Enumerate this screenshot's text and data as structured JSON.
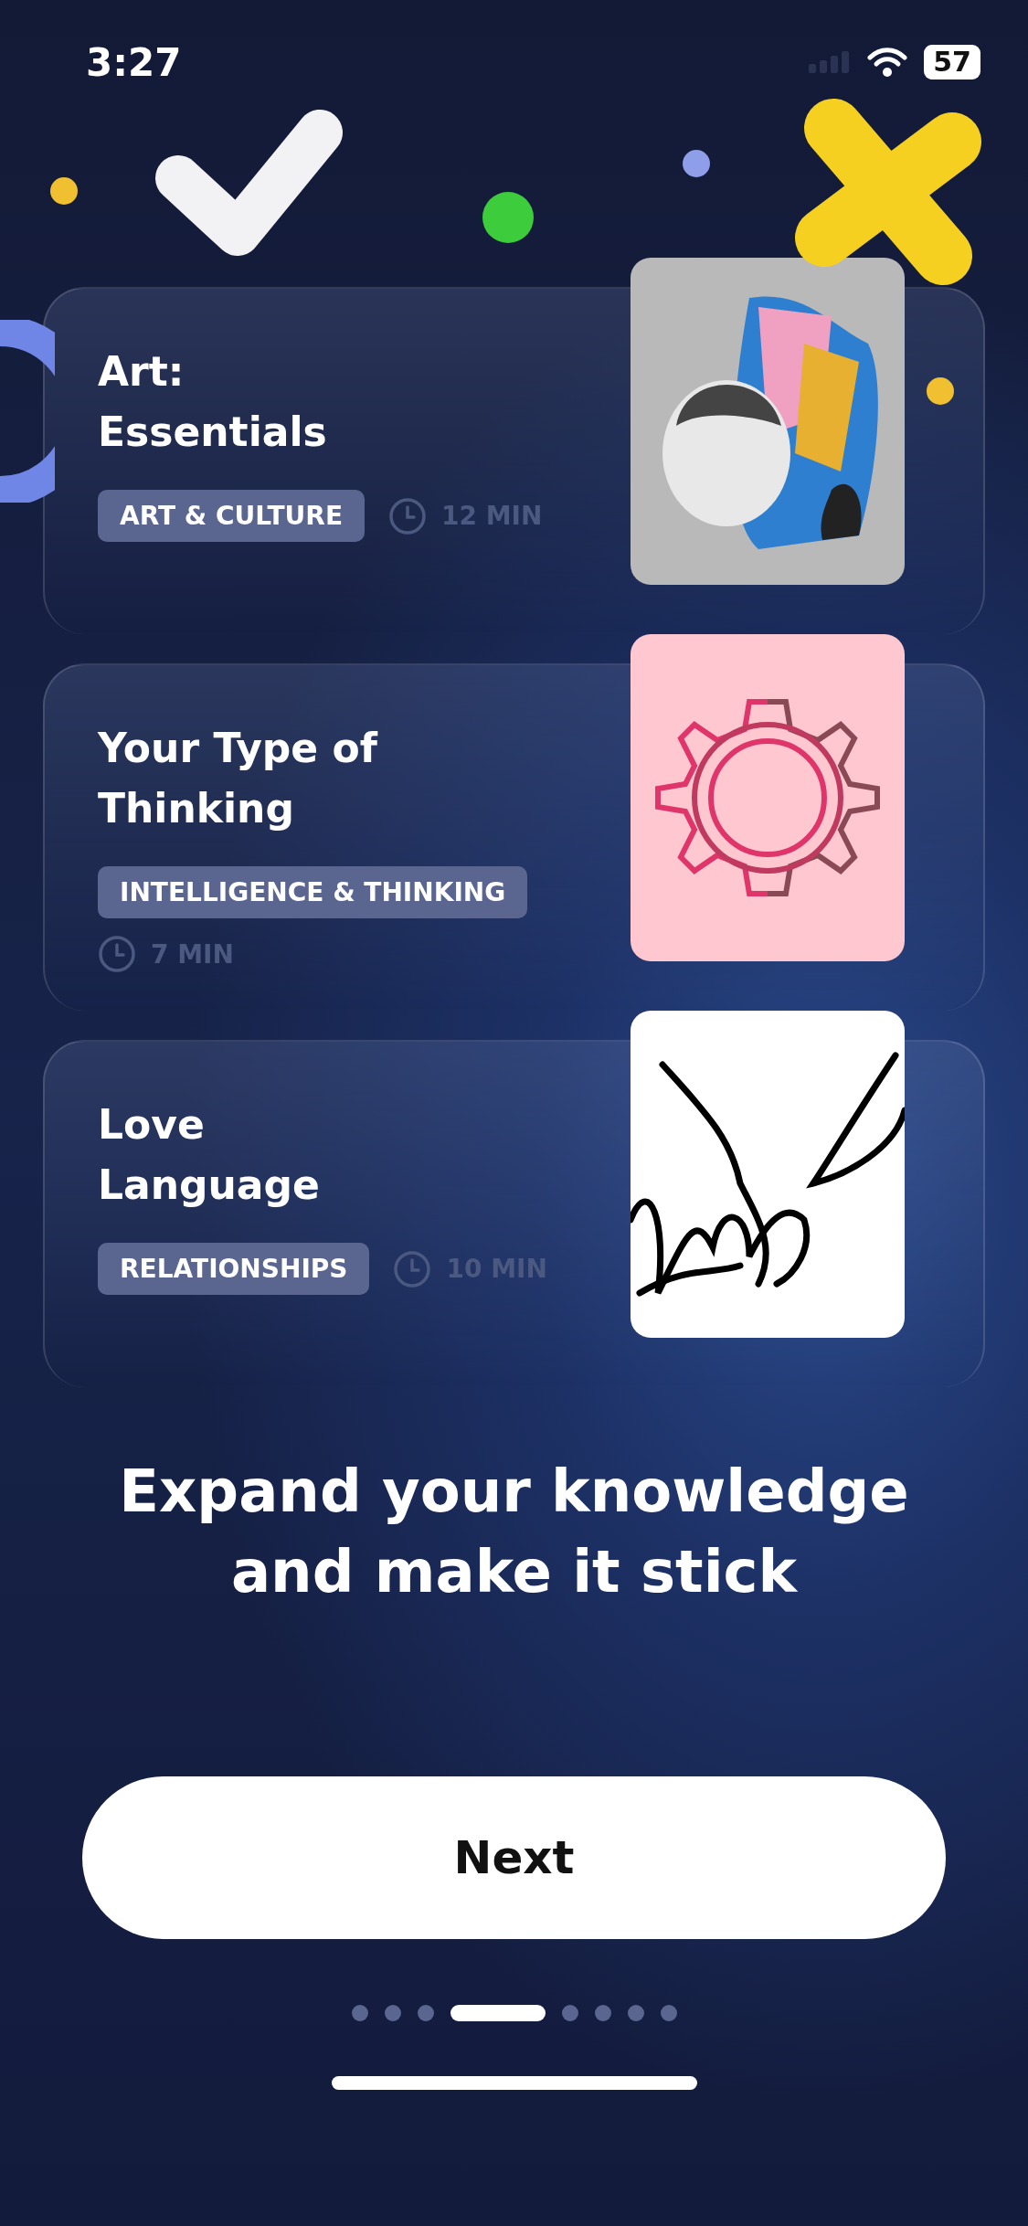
{
  "status_bar": {
    "time": "3:27",
    "battery": "57"
  },
  "cards": [
    {
      "title_lines": [
        "Art:",
        "Essentials"
      ],
      "tag": "ART & CULTURE",
      "duration": "12 MIN",
      "kind": "collage"
    },
    {
      "title_lines": [
        "Your Type of",
        "Thinking"
      ],
      "tag": "INTELLIGENCE & THINKING",
      "duration": "7 MIN",
      "kind": "gear"
    },
    {
      "title_lines": [
        "Love",
        "Language"
      ],
      "tag": "RELATIONSHIPS",
      "duration": "10 MIN",
      "kind": "hands"
    }
  ],
  "headline_lines": [
    "Expand your knowledge",
    "and make it stick"
  ],
  "button": {
    "label": "Next"
  },
  "pagination": [
    {
      "selected": false
    },
    {
      "selected": false
    },
    {
      "selected": false
    },
    {
      "selected": true
    },
    {
      "selected": false
    },
    {
      "selected": false
    },
    {
      "selected": false
    },
    {
      "selected": false
    }
  ]
}
